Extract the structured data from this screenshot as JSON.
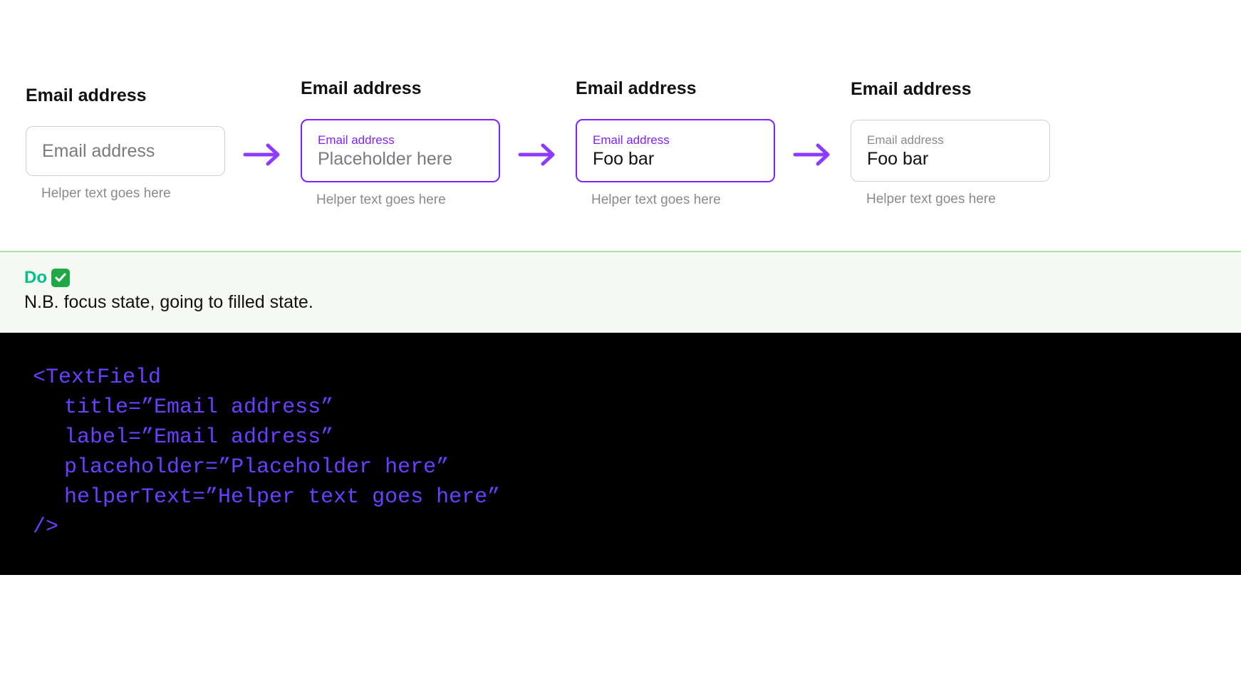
{
  "fields": [
    {
      "title": "Email address",
      "placeholder": "Email address",
      "helper": "Helper text goes here"
    },
    {
      "title": "Email address",
      "inner_label": "Email address",
      "placeholder": "Placeholder here",
      "helper": "Helper text goes here"
    },
    {
      "title": "Email address",
      "inner_label": "Email address",
      "value": "Foo bar",
      "helper": "Helper text goes here"
    },
    {
      "title": "Email address",
      "inner_label": "Email address",
      "value": "Foo bar",
      "helper": "Helper text goes here"
    }
  ],
  "do_block": {
    "label": "Do",
    "description": "N.B. focus state, going to filled state."
  },
  "code": {
    "open": "<TextField",
    "attrs": [
      {
        "name": "title",
        "value": "”Email address”"
      },
      {
        "name": "label",
        "value": "”Email address”"
      },
      {
        "name": "placeholder",
        "value": "”Placeholder here”"
      },
      {
        "name": "helperText",
        "value": "”Helper text goes here”"
      }
    ],
    "close": "/>"
  },
  "colors": {
    "accent": "#7e22ff",
    "do_green": "#00c08b"
  }
}
